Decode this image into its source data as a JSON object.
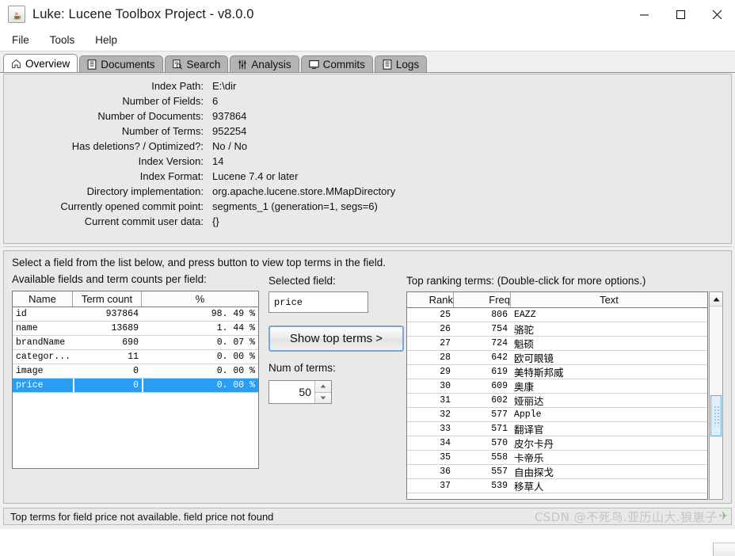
{
  "window": {
    "title": "Luke: Lucene Toolbox Project - v8.0.0",
    "app_icon": "java-coffee-cup-icon",
    "minimize_label": "minimize-icon",
    "maximize_label": "maximize-icon",
    "close_label": "close-icon"
  },
  "menu": {
    "items": [
      {
        "label": "File"
      },
      {
        "label": "Tools"
      },
      {
        "label": "Help"
      }
    ]
  },
  "tabs": [
    {
      "label": "Overview",
      "icon": "home-icon",
      "active": true
    },
    {
      "label": "Documents",
      "icon": "document-icon",
      "active": false
    },
    {
      "label": "Search",
      "icon": "search-document-icon",
      "active": false
    },
    {
      "label": "Analysis",
      "icon": "analysis-sliders-icon",
      "active": false
    },
    {
      "label": "Commits",
      "icon": "monitor-icon",
      "active": false
    },
    {
      "label": "Logs",
      "icon": "document-icon",
      "active": false
    }
  ],
  "overview": {
    "rows": [
      {
        "label": "Index Path:",
        "value": "E:\\dir"
      },
      {
        "label": "Number of Fields:",
        "value": "6"
      },
      {
        "label": "Number of Documents:",
        "value": "937864"
      },
      {
        "label": "Number of Terms:",
        "value": "952254"
      },
      {
        "label": "Has deletions? / Optimized?:",
        "value": "No / No"
      },
      {
        "label": "Index Version:",
        "value": "14"
      },
      {
        "label": "Index Format:",
        "value": "Lucene 7.4 or later"
      },
      {
        "label": "Directory implementation:",
        "value": "org.apache.lucene.store.MMapDirectory"
      },
      {
        "label": "Currently opened commit point:",
        "value": "segments_1 (generation=1, segs=6)"
      },
      {
        "label": "Current commit user data:",
        "value": "{}"
      }
    ]
  },
  "bottom": {
    "hint": "Select a field from the list below, and press button to view top terms in the field.",
    "fields": {
      "label": "Available fields and term counts per field:",
      "columns": [
        "Name",
        "Term count",
        "%"
      ],
      "rows": [
        {
          "name": "id",
          "term_count": "937864",
          "pct": "98. 49 %",
          "selected": false
        },
        {
          "name": "name",
          "term_count": "13689",
          "pct": "1. 44 %",
          "selected": false
        },
        {
          "name": "brandName",
          "term_count": "690",
          "pct": "0. 07 %",
          "selected": false
        },
        {
          "name": "categor...",
          "term_count": "11",
          "pct": "0. 00 %",
          "selected": false
        },
        {
          "name": "image",
          "term_count": "0",
          "pct": "0. 00 %",
          "selected": false
        },
        {
          "name": "price",
          "term_count": "0",
          "pct": "0. 00 %",
          "selected": true
        }
      ]
    },
    "selected_field": {
      "label": "Selected field:",
      "value": "price"
    },
    "show_top_terms_button": "Show top terms >",
    "num_of_terms": {
      "label": "Num of terms:",
      "value": "50",
      "up_icon": "spinner-up-icon",
      "down_icon": "spinner-down-icon"
    },
    "terms": {
      "label": "Top ranking terms: (Double-click for more options.)",
      "columns": [
        "Rank",
        "Freq",
        "Text"
      ],
      "rows": [
        {
          "rank": "25",
          "freq": "806",
          "text": "EAZZ",
          "cjk": false
        },
        {
          "rank": "26",
          "freq": "754",
          "text": "骆驼",
          "cjk": true
        },
        {
          "rank": "27",
          "freq": "724",
          "text": "魁硕",
          "cjk": true
        },
        {
          "rank": "28",
          "freq": "642",
          "text": "欧可眼镜",
          "cjk": true
        },
        {
          "rank": "29",
          "freq": "619",
          "text": "美特斯邦威",
          "cjk": true
        },
        {
          "rank": "30",
          "freq": "609",
          "text": "奥康",
          "cjk": true
        },
        {
          "rank": "31",
          "freq": "602",
          "text": "娅丽达",
          "cjk": true
        },
        {
          "rank": "32",
          "freq": "577",
          "text": "Apple",
          "cjk": false
        },
        {
          "rank": "33",
          "freq": "571",
          "text": "翻译官",
          "cjk": true
        },
        {
          "rank": "34",
          "freq": "570",
          "text": "皮尔卡丹",
          "cjk": true
        },
        {
          "rank": "35",
          "freq": "558",
          "text": "卡帝乐",
          "cjk": true
        },
        {
          "rank": "36",
          "freq": "557",
          "text": "自由探戈",
          "cjk": true
        },
        {
          "rank": "37",
          "freq": "539",
          "text": "移草人",
          "cjk": true
        }
      ],
      "scroll_up_icon": "scroll-up-arrow-icon",
      "scroll_down_icon": "scroll-down-arrow-icon"
    }
  },
  "status": {
    "message": "Top terms for field price not available. field price not found"
  },
  "watermark": {
    "text": "CSDN @不死鸟.亚历山大.狼崽子"
  },
  "colors": {
    "selection": "#2a9df4",
    "panel": "#e9e9e9",
    "tab_inactive": "#b4b4b4"
  }
}
